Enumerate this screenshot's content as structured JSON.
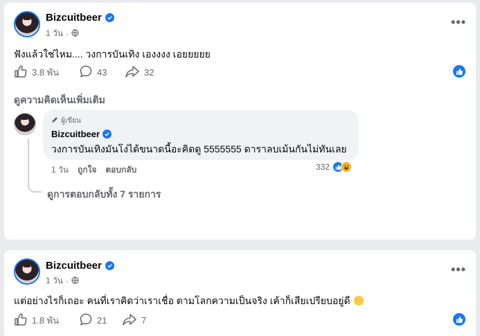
{
  "post1": {
    "author": "Bizcuitbeer",
    "time": "1 วัน",
    "text": "ฟังแล้วใช่ไหม.... วงการบันเทิง เองงงง เอยยยยย",
    "likes": "3.8 พัน",
    "comments": "43",
    "shares": "32",
    "more_comments_label": "ดูความคิดเห็นเพิ่มเติม",
    "comment": {
      "author_tag": "ผู้เขียน",
      "author": "Bizcuitbeer",
      "text": "วงการบันเทิงมันโง่ได้ขนาดนี้อะคิดดู 5555555 ดาราลบเม้นกันไม่ทันเลย",
      "time": "1 วัน",
      "like_label": "ถูกใจ",
      "reply_label": "ตอบกลับ",
      "reaction_count": "332"
    },
    "view_replies_label": "ดูการตอบกลับทั้ง 7 รายการ"
  },
  "post2": {
    "author": "Bizcuitbeer",
    "time": "1 วัน",
    "text": "แต่อย่างไรก็เถอะ คนที่เราคิดว่าเราเชื่อ ตามโลกความเป็นจริง เค้าก็เสียเปรียบอยู่ดี",
    "likes": "1.8 พัน",
    "comments": "21",
    "shares": "7"
  },
  "icons": {
    "verified": "verified-badge-icon",
    "globe": "globe-icon",
    "more": "more-options-icon",
    "like": "thumbs-up-icon",
    "comment": "comment-icon",
    "share": "share-icon"
  },
  "colors": {
    "accent": "#1877f2",
    "secondary_text": "#65676b",
    "bubble": "#f0f2f5"
  }
}
